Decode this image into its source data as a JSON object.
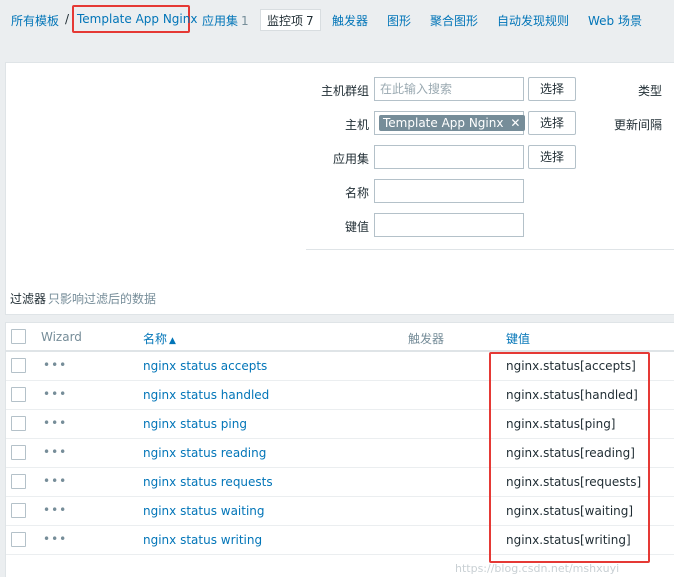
{
  "breadcrumb": {
    "all_templates": "所有模板",
    "separator": "/",
    "current": "Template App Nginx"
  },
  "tabs": [
    {
      "label": "应用集",
      "count": "1"
    },
    {
      "label": "监控项",
      "count": "7"
    },
    {
      "label": "触发器"
    },
    {
      "label": "图形"
    },
    {
      "label": "聚合图形"
    },
    {
      "label": "自动发现规则"
    },
    {
      "label": "Web 场景"
    }
  ],
  "filter": {
    "host_group_label": "主机群组",
    "host_group_placeholder": "在此输入搜索",
    "select_label": "选择",
    "type_label": "类型",
    "host_label": "主机",
    "host_tag": "Template App Nginx",
    "tag_remove": "✕",
    "update_interval_label": "更新间隔",
    "application_label": "应用集",
    "application_value": "",
    "name_label": "名称",
    "name_value": "",
    "key_label": "键值",
    "key_value": "",
    "tab_label": "过滤器",
    "tab_hint": "只影响过滤后的数据"
  },
  "table": {
    "columns": {
      "wizard": "Wizard",
      "name": "名称",
      "name_sort": "▲",
      "triggers": "触发器",
      "key": "键值"
    },
    "rows": [
      {
        "wizard": "•••",
        "name": "nginx status accepts",
        "key": "nginx.status[accepts]"
      },
      {
        "wizard": "•••",
        "name": "nginx status handled",
        "key": "nginx.status[handled]"
      },
      {
        "wizard": "•••",
        "name": "nginx status ping",
        "key": "nginx.status[ping]"
      },
      {
        "wizard": "•••",
        "name": "nginx status reading",
        "key": "nginx.status[reading]"
      },
      {
        "wizard": "•••",
        "name": "nginx status requests",
        "key": "nginx.status[requests]"
      },
      {
        "wizard": "•••",
        "name": "nginx status waiting",
        "key": "nginx.status[waiting]"
      },
      {
        "wizard": "•••",
        "name": "nginx status writing",
        "key": "nginx.status[writing]"
      }
    ]
  },
  "watermark": "https://blog.csdn.net/mshxuyi",
  "colors": {
    "link": "#0275b8",
    "highlight": "#e53935",
    "tag_bg": "#768d99"
  }
}
